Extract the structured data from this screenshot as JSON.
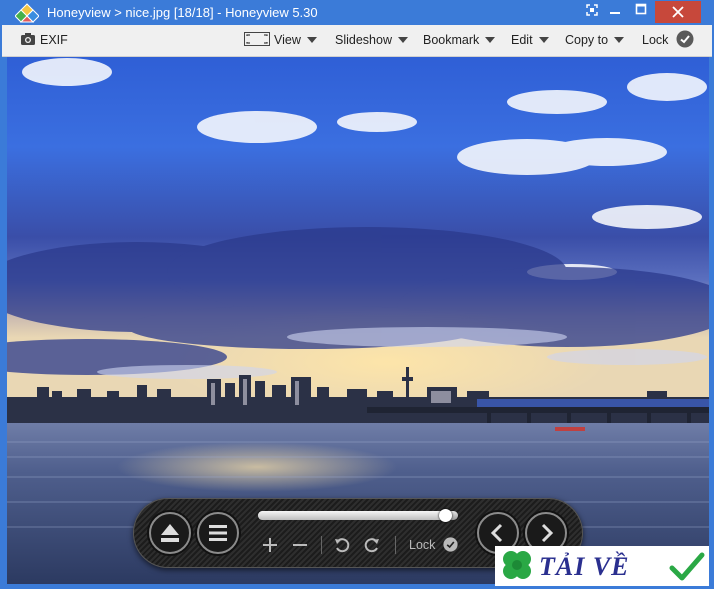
{
  "titlebar": {
    "title": "Honeyview  >  nice.jpg  [18/18]  -  Honeyview  5.30"
  },
  "toolbar": {
    "exif_label": "EXIF",
    "view_label": "View",
    "slideshow_label": "Slideshow",
    "bookmark_label": "Bookmark",
    "edit_label": "Edit",
    "copy_to_label": "Copy to",
    "lock_label": "Lock"
  },
  "controls": {
    "lock_label": "Lock",
    "slider_progress": 0.94
  },
  "watermark": {
    "text": "TẢI VỀ"
  },
  "colors": {
    "titlebar": "#3b7bd8",
    "close_button": "#c7483b",
    "toolbar_bg": "#f0f0f0",
    "controlbar_bg": "#232323",
    "watermark_text": "#2a2f8f",
    "watermark_check": "#2aa845"
  }
}
